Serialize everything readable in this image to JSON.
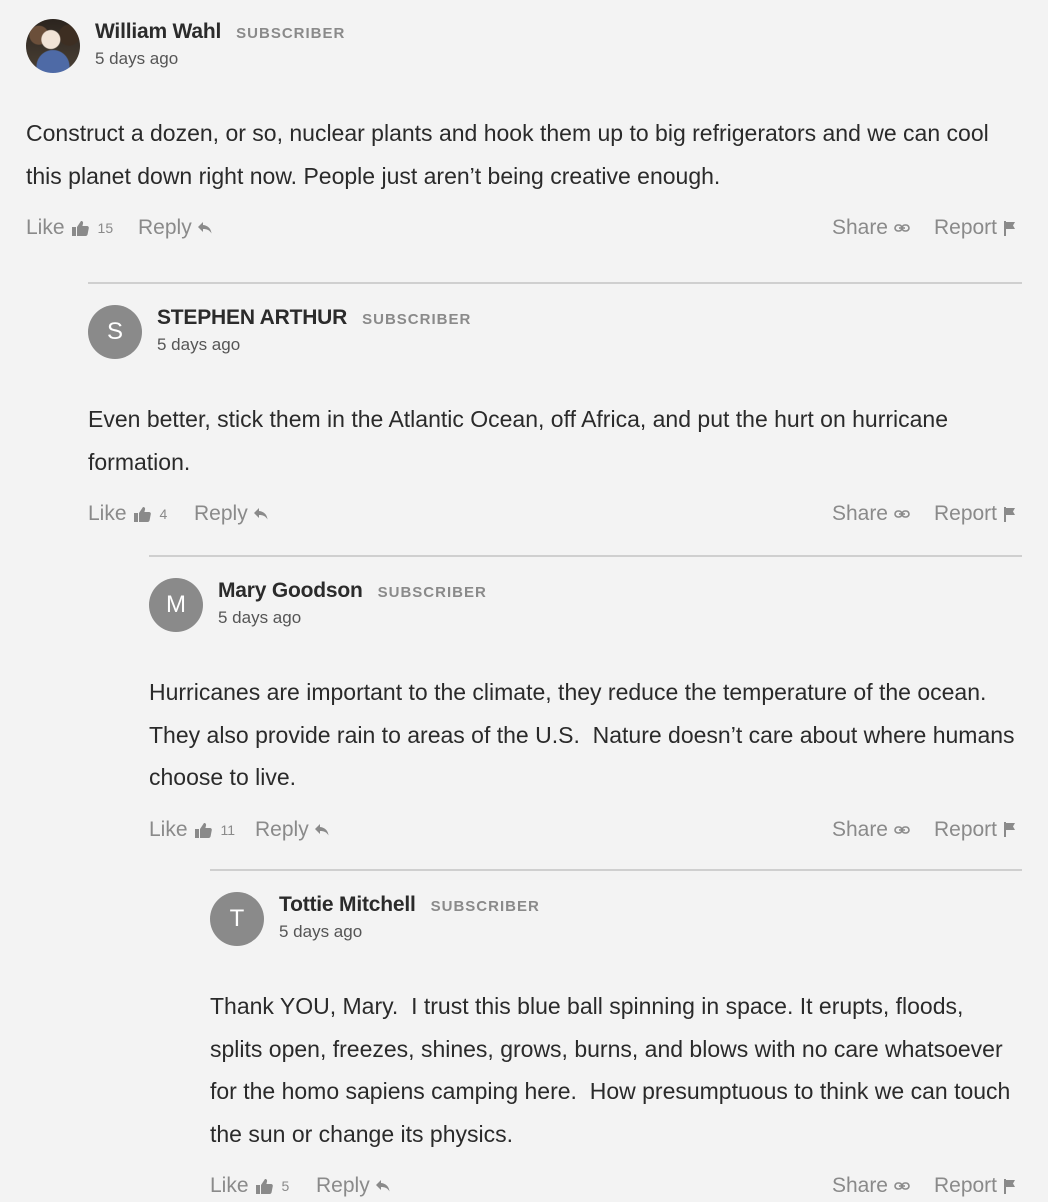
{
  "comments": [
    {
      "author": "William Wahl",
      "badge": "SUBSCRIBER",
      "time": "5 days ago",
      "avatar_initial": "",
      "avatar_type": "photo",
      "text": "Construct a dozen, or so, nuclear plants and hook them up to big refrigerators and we can cool this planet down right now. People just aren’t being creative enough.",
      "like_label": "Like",
      "like_count": "15",
      "reply_label": "Reply",
      "share_label": "Share",
      "report_label": "Report"
    },
    {
      "author": "STEPHEN ARTHUR",
      "badge": "SUBSCRIBER",
      "time": "5 days ago",
      "avatar_initial": "S",
      "avatar_type": "initial",
      "text": "Even better, stick them in the Atlantic Ocean, off Africa, and put the hurt on hurricane formation.",
      "like_label": "Like",
      "like_count": "4",
      "reply_label": "Reply",
      "share_label": "Share",
      "report_label": "Report"
    },
    {
      "author": "Mary Goodson",
      "badge": "SUBSCRIBER",
      "time": "5 days ago",
      "avatar_initial": "M",
      "avatar_type": "initial",
      "text": "Hurricanes are important to the climate, they reduce the temperature of the ocean.  They also provide rain to areas of the U.S.  Nature doesn’t care about where humans choose to live.",
      "like_label": "Like",
      "like_count": "11",
      "reply_label": "Reply",
      "share_label": "Share",
      "report_label": "Report"
    },
    {
      "author": "Tottie Mitchell",
      "badge": "SUBSCRIBER",
      "time": "5 days ago",
      "avatar_initial": "T",
      "avatar_type": "initial",
      "text": "Thank YOU, Mary.  I trust this blue ball spinning in space. It erupts, floods, splits open, freezes, shines, grows, burns, and blows with no care whatsoever for the homo sapiens camping here.  How presumptuous to think we can touch the sun or change its physics.",
      "like_label": "Like",
      "like_count": "5",
      "reply_label": "Reply",
      "share_label": "Share",
      "report_label": "Report"
    }
  ],
  "icons": {
    "like": "thumbs-up-icon",
    "reply": "reply-arrow-icon",
    "share": "link-icon",
    "report": "flag-icon"
  },
  "colors": {
    "background": "#f3f3f3",
    "avatar": "#8a8a8a",
    "muted": "#8a8a8a",
    "divider": "#cfcfcf"
  }
}
